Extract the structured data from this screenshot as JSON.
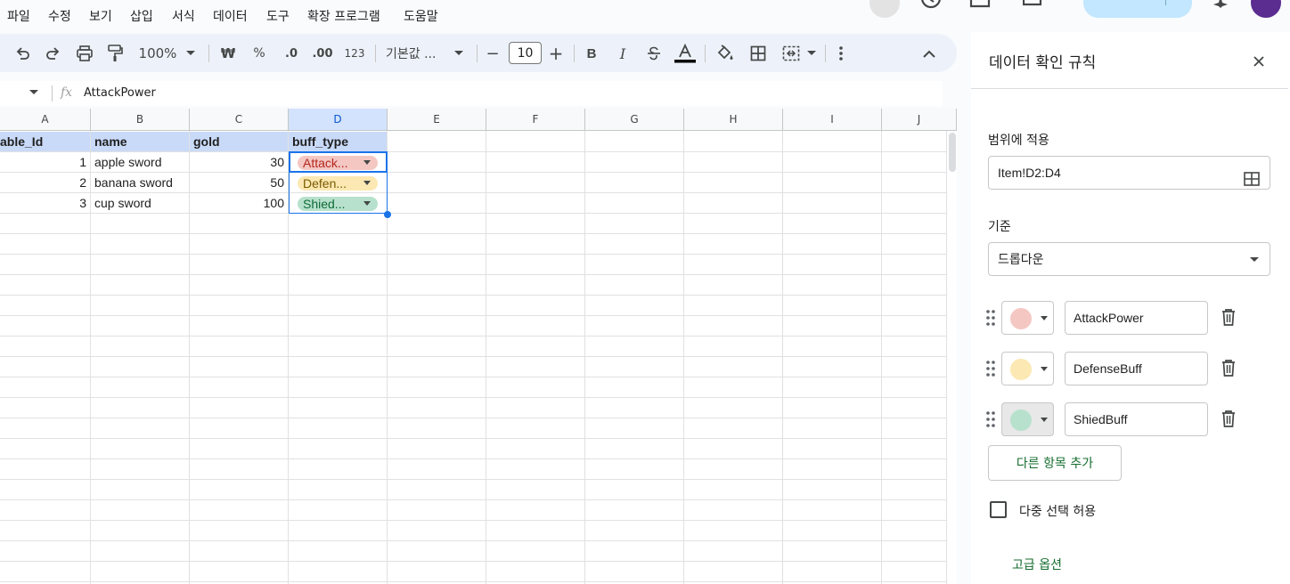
{
  "menu": {
    "items": [
      "파일",
      "수정",
      "보기",
      "삽입",
      "서식",
      "데이터",
      "도구",
      "확장 프로그램",
      "도움말"
    ]
  },
  "toolbar": {
    "zoom": "100%",
    "currency": "₩",
    "percent": "%",
    "decrease_decimal": ".0",
    "increase_decimal": ".00",
    "number_format": "123",
    "font_name": "기본값 ...",
    "font_size": "10",
    "minus": "−",
    "plus": "+",
    "bold": "B",
    "italic": "I"
  },
  "formula_bar": {
    "fx": "fx",
    "content": "AttackPower"
  },
  "grid": {
    "columns": [
      "A",
      "B",
      "C",
      "D",
      "E",
      "F",
      "G",
      "H",
      "I",
      "J"
    ],
    "selected_column": "D",
    "header_row": [
      "able_Id",
      "name",
      "gold",
      "buff_type"
    ],
    "rows": [
      {
        "id": "1",
        "name": "apple sword",
        "gold": "30",
        "buff": "Attack..."
      },
      {
        "id": "2",
        "name": "banana sword",
        "gold": "50",
        "buff": "Defen..."
      },
      {
        "id": "3",
        "name": "cup sword",
        "gold": "100",
        "buff": "Shied..."
      }
    ],
    "chip_colors": [
      "#f4c7c3",
      "#fce8b2",
      "#b7e1cd"
    ],
    "chip_text_colors": [
      "#b3261e",
      "#7a5a00",
      "#0f6b37"
    ]
  },
  "panel": {
    "title": "데이터 확인 규칙",
    "range_label": "범위에 적용",
    "range_value": "Item!D2:D4",
    "criteria_label": "기준",
    "criteria_value": "드롭다운",
    "items": [
      {
        "value": "AttackPower",
        "color": "#f4c7c3"
      },
      {
        "value": "DefenseBuff",
        "color": "#fce8b2"
      },
      {
        "value": "ShiedBuff",
        "color": "#b7e1cd"
      }
    ],
    "add_item_label": "다른 항목 추가",
    "multi_select_label": "다중 선택 허용",
    "multi_select_checked": false,
    "advanced_label": "고급 옵션"
  },
  "accent_color": "#1a73e8",
  "share_color": "#c2e7ff",
  "avatar_color": "#5b2d91"
}
